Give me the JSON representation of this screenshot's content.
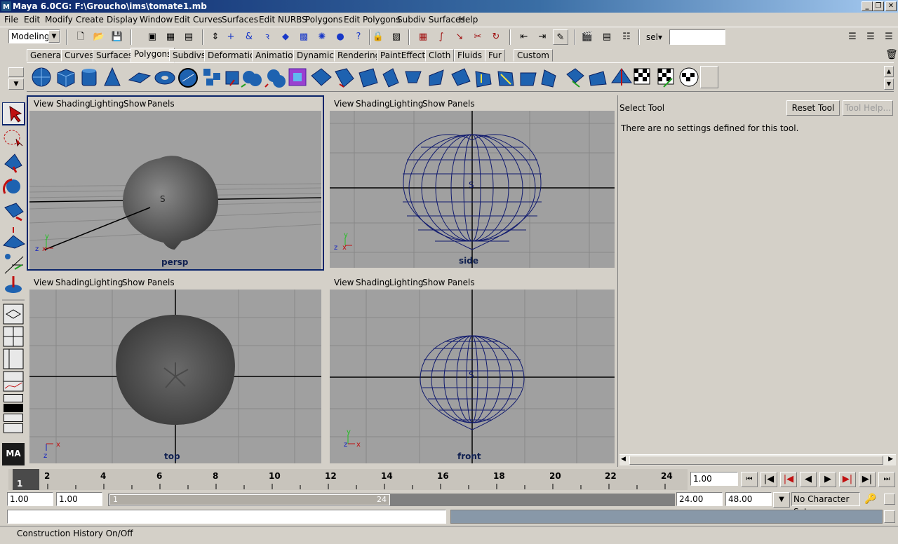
{
  "window": {
    "title": "Maya 6.0CG: F:\\Groucho\\ims\\tomate1.mb"
  },
  "menubar": [
    "File",
    "Edit",
    "Modify",
    "Create",
    "Display",
    "Window",
    "Edit Curves",
    "Surfaces",
    "Edit NURBS",
    "Polygons",
    "Edit Polygons",
    "Subdiv Surfaces",
    "Help"
  ],
  "statusline": {
    "mode": "Modeling",
    "sel_label": "sel▾",
    "sel_value": ""
  },
  "shelf_tabs": [
    "General",
    "Curves",
    "Surfaces",
    "Polygons",
    "Subdivs",
    "Deformation",
    "Animation",
    "Dynamics",
    "Rendering",
    "PaintEffects",
    "Cloth",
    "Fluids",
    "Fur",
    "Custom"
  ],
  "active_shelf_tab": "Polygons",
  "viewport_menu": [
    "View",
    "Shading",
    "Lighting",
    "Show",
    "Panels"
  ],
  "viewports": {
    "persp": "persp",
    "side": "side",
    "top": "top",
    "front": "front"
  },
  "object_label": "S",
  "axes": {
    "x": "x",
    "y": "y",
    "z": "z"
  },
  "tool_settings": {
    "title": "Select Tool",
    "reset": "Reset Tool",
    "help": "Tool Help...",
    "message": "There are no settings defined for this tool."
  },
  "timeline": {
    "ticks": [
      "2",
      "4",
      "6",
      "8",
      "10",
      "12",
      "14",
      "16",
      "18",
      "20",
      "22",
      "24"
    ],
    "current_frame": "1",
    "current_time": "1.00"
  },
  "range": {
    "start": "1.00",
    "start2": "1.00",
    "slider_start": "1",
    "slider_end": "24",
    "end": "24.00",
    "end2": "48.00",
    "character_set": "No Character Set"
  },
  "helpline": "Construction History On/Off",
  "colors": {
    "wire": "#101a6e",
    "accent": "#0a246a",
    "viewport_bg": "#a0a0a0"
  }
}
